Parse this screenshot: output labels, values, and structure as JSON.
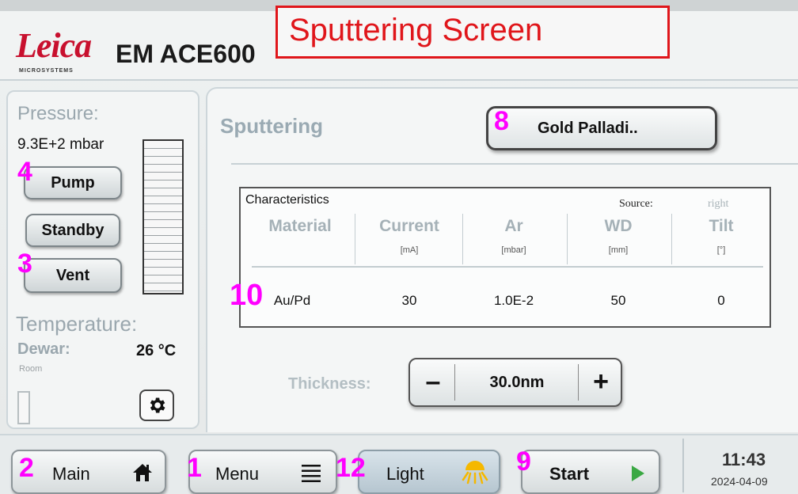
{
  "header": {
    "logo": "Leica",
    "logo_sub": "MICROSYSTEMS",
    "product": "EM ACE600",
    "screen_title": "Sputtering Screen"
  },
  "left": {
    "pressure_label": "Pressure:",
    "pressure_value": "9.3E+2 mbar",
    "buttons": {
      "pump": "Pump",
      "standby": "Standby",
      "vent": "Vent"
    },
    "temperature_label": "Temperature:",
    "dewar_label": "Dewar:",
    "dewar_value": "26 °C",
    "room_label": "Room"
  },
  "main": {
    "heading": "Sputtering",
    "material_select": "Gold Palladi..",
    "characteristics": {
      "title": "Characteristics",
      "source_label": "Source:",
      "source_value": "right",
      "columns": [
        {
          "name": "Material",
          "unit": ""
        },
        {
          "name": "Current",
          "unit": "[mA]"
        },
        {
          "name": "Ar",
          "unit": "[mbar]"
        },
        {
          "name": "WD",
          "unit": "[mm]"
        },
        {
          "name": "Tilt",
          "unit": "[°]"
        }
      ],
      "row": [
        "Au/Pd",
        "30",
        "1.0E-2",
        "50",
        "0"
      ]
    },
    "thickness_label": "Thickness:",
    "thickness_value": "30.0nm",
    "minus": "–",
    "plus": "+"
  },
  "bottom": {
    "main": "Main",
    "menu": "Menu",
    "light": "Light",
    "start": "Start",
    "time": "11:43",
    "date": "2024-04-09"
  },
  "annotations": {
    "a1": "1",
    "a2": "2",
    "a3": "3",
    "a4": "4",
    "a8": "8",
    "a9": "9",
    "a10": "10",
    "a12": "12"
  },
  "colors": {
    "brand_red": "#c8102e",
    "annotation_magenta": "#ff00ff",
    "title_box_red": "#e0161b",
    "start_arrow_green": "#3aa843",
    "light_sun_yellow": "#f5b800"
  },
  "icons": {
    "home": "home-icon",
    "menu": "hamburger-menu-icon",
    "light": "sun-icon",
    "start": "play-arrow-icon",
    "settings": "gear-icon"
  }
}
